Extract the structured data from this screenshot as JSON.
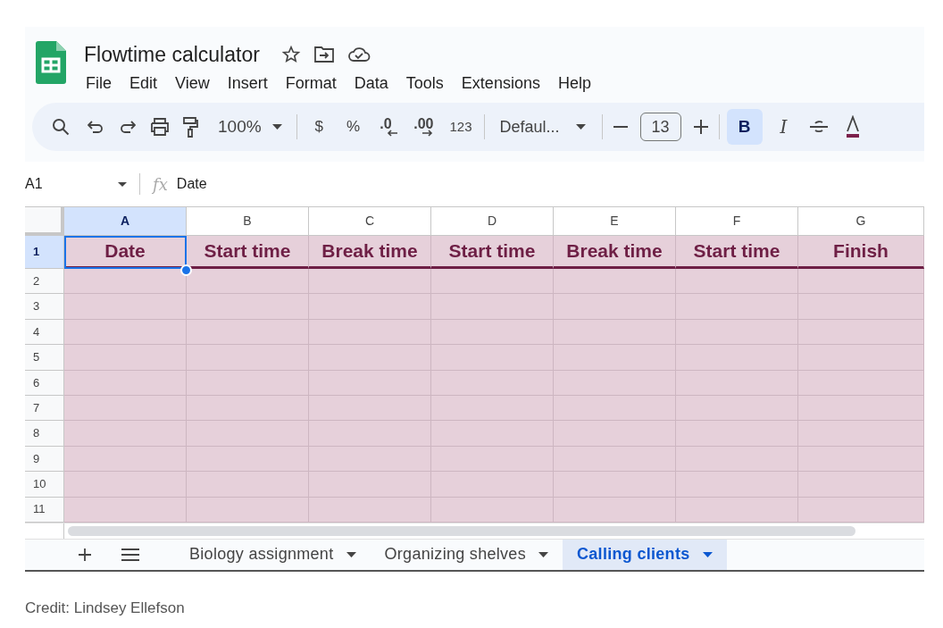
{
  "document": {
    "title": "Flowtime calculator"
  },
  "menu": [
    "File",
    "Edit",
    "View",
    "Insert",
    "Format",
    "Data",
    "Tools",
    "Extensions",
    "Help"
  ],
  "toolbar": {
    "zoom": "100%",
    "currency": "$",
    "percent": "%",
    "decrease_decimals": ".0",
    "increase_decimals": ".00",
    "number_format": "123",
    "font": "Defaul...",
    "font_size": "13",
    "bold": {
      "label": "B",
      "on": true
    },
    "italic": {
      "label": "I",
      "on": false
    }
  },
  "formula_bar": {
    "cell": "A1",
    "function_label": "fx",
    "content": "Date"
  },
  "columns": [
    {
      "label": "A",
      "selected": true
    },
    {
      "label": "B",
      "selected": false
    },
    {
      "label": "C",
      "selected": false
    },
    {
      "label": "D",
      "selected": false
    },
    {
      "label": "E",
      "selected": false
    },
    {
      "label": "F",
      "selected": false
    },
    {
      "label": "G",
      "selected": false
    }
  ],
  "rows": [
    {
      "number": "1",
      "selected": true,
      "cells": [
        {
          "value": "Date",
          "selected": true
        },
        {
          "value": "Start time",
          "selected": false
        },
        {
          "value": "Break time",
          "selected": false
        },
        {
          "value": "Start time",
          "selected": false
        },
        {
          "value": "Break time",
          "selected": false
        },
        {
          "value": "Start time",
          "selected": false
        },
        {
          "value": "Finish",
          "selected": false
        }
      ]
    },
    {
      "number": "2",
      "selected": false
    },
    {
      "number": "3",
      "selected": false
    },
    {
      "number": "4",
      "selected": false
    },
    {
      "number": "5",
      "selected": false
    },
    {
      "number": "6",
      "selected": false
    },
    {
      "number": "7",
      "selected": false
    },
    {
      "number": "8",
      "selected": false
    },
    {
      "number": "9",
      "selected": false
    },
    {
      "number": "10",
      "selected": false
    },
    {
      "number": "11",
      "selected": false
    }
  ],
  "sheet_tabs": [
    {
      "label": "Biology assignment",
      "selected": false
    },
    {
      "label": "Organizing shelves",
      "selected": false
    },
    {
      "label": "Calling clients",
      "selected": true
    }
  ],
  "credit": "Credit: Lindsey Ellefson"
}
